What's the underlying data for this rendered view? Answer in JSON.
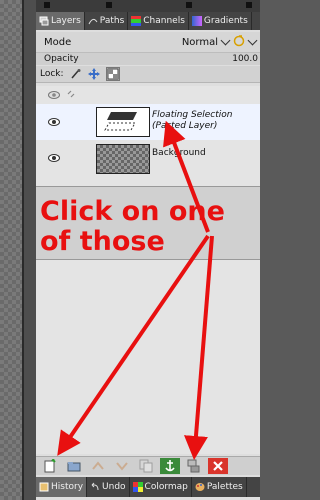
{
  "tabs": [
    {
      "label": "Layers",
      "active": true,
      "icon": "layers-icon"
    },
    {
      "label": "Paths",
      "active": false,
      "icon": "paths-icon"
    },
    {
      "label": "Channels",
      "active": false,
      "icon": "channels-icon"
    },
    {
      "label": "Gradients",
      "active": false,
      "icon": "gradients-icon"
    }
  ],
  "mode": {
    "label": "Mode",
    "value": "Normal"
  },
  "opacity": {
    "label": "Opacity",
    "value": "100.0"
  },
  "lock": {
    "label": "Lock:"
  },
  "layers": [
    {
      "name_line1": "Floating Selection",
      "name_line2": "(Pasted Layer)",
      "selected": true
    },
    {
      "name_line1": "Background",
      "name_line2": "",
      "selected": false
    }
  ],
  "annotation": {
    "text": "Click on one of those"
  },
  "toolbar": {
    "buttons": [
      "new-layer-icon",
      "new-layer-group-icon",
      "raise-layer-icon",
      "lower-layer-icon",
      "duplicate-layer-icon",
      "anchor-layer-icon",
      "merge-down-icon",
      "delete-layer-icon"
    ]
  },
  "bottom_tabs": [
    {
      "label": "History",
      "active": true,
      "icon": "history-icon"
    },
    {
      "label": "Undo",
      "active": false,
      "icon": "undo-icon"
    },
    {
      "label": "Colormap",
      "active": false,
      "icon": "colormap-icon"
    },
    {
      "label": "Palettes",
      "active": false,
      "icon": "palettes-icon"
    }
  ],
  "colors": {
    "annotation": "#e81010",
    "arrow": "#e81010"
  }
}
